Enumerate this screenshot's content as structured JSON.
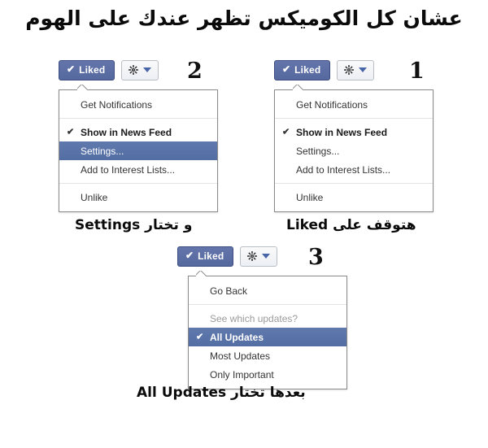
{
  "page": {
    "title": "عشان كل الكوميكس تظهر عندك على الهوم",
    "background_color": "#ffffff"
  },
  "colors": {
    "liked_button_blue": "#5b6fa6",
    "menu_highlight_blue": "#5973a8",
    "caret_blue": "#4865a8",
    "menu_border": "#8a8a8a",
    "separator": "#e3e3e3",
    "muted_text": "#9a9a9a",
    "text": "#333333"
  },
  "button": {
    "liked_label": "Liked",
    "check_glyph": "✔",
    "gear_icon_name": "gear-icon",
    "caret_icon_name": "chevron-down-icon"
  },
  "panels": [
    {
      "id": "panel-1",
      "step_number": "1",
      "caption": "هتوقف على Liked",
      "menu_items": [
        {
          "label": "Get Notifications",
          "checked": false,
          "bold": false,
          "muted": false,
          "selected": false
        },
        {
          "separator": true
        },
        {
          "label": "Show in News Feed",
          "checked": true,
          "bold": true,
          "muted": false,
          "selected": false
        },
        {
          "label": "Settings...",
          "checked": false,
          "bold": false,
          "muted": false,
          "selected": false
        },
        {
          "label": "Add to Interest Lists...",
          "checked": false,
          "bold": false,
          "muted": false,
          "selected": false
        },
        {
          "separator": true
        },
        {
          "label": "Unlike",
          "checked": false,
          "bold": false,
          "muted": false,
          "selected": false
        }
      ]
    },
    {
      "id": "panel-2",
      "step_number": "2",
      "caption": "و تختار Settings",
      "menu_items": [
        {
          "label": "Get Notifications",
          "checked": false,
          "bold": false,
          "muted": false,
          "selected": false
        },
        {
          "separator": true
        },
        {
          "label": "Show in News Feed",
          "checked": true,
          "bold": true,
          "muted": false,
          "selected": false
        },
        {
          "label": "Settings...",
          "checked": false,
          "bold": false,
          "muted": false,
          "selected": true
        },
        {
          "label": "Add to Interest Lists...",
          "checked": false,
          "bold": false,
          "muted": false,
          "selected": false
        },
        {
          "separator": true
        },
        {
          "label": "Unlike",
          "checked": false,
          "bold": false,
          "muted": false,
          "selected": false
        }
      ]
    },
    {
      "id": "panel-3",
      "step_number": "3",
      "caption": "بعدها تختار All Updates",
      "menu_items": [
        {
          "label": "Go Back",
          "checked": false,
          "bold": false,
          "muted": false,
          "selected": false
        },
        {
          "separator": true
        },
        {
          "label": "See which updates?",
          "checked": false,
          "bold": false,
          "muted": true,
          "selected": false
        },
        {
          "label": "All Updates",
          "checked": true,
          "bold": true,
          "muted": false,
          "selected": true
        },
        {
          "label": "Most Updates",
          "checked": false,
          "bold": false,
          "muted": false,
          "selected": false
        },
        {
          "label": "Only Important",
          "checked": false,
          "bold": false,
          "muted": false,
          "selected": false
        }
      ]
    }
  ]
}
